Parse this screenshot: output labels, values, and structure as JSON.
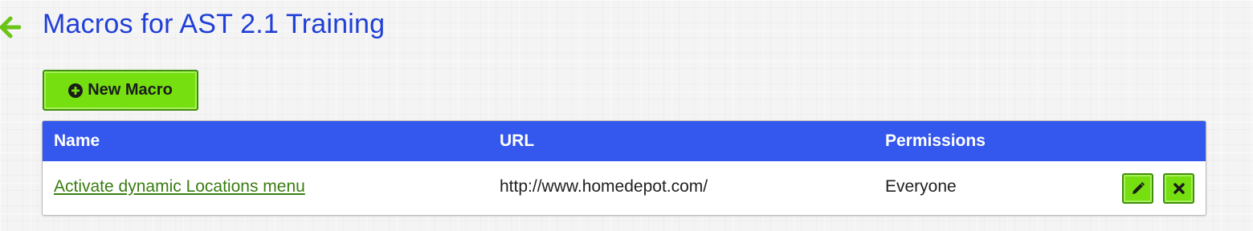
{
  "header": {
    "back_icon": "arrow-left-icon",
    "title": "Macros for AST 2.1 Training"
  },
  "toolbar": {
    "new_macro_label": "New Macro",
    "new_macro_icon": "plus-circle-icon"
  },
  "table": {
    "columns": [
      "Name",
      "URL",
      "Permissions"
    ],
    "rows": [
      {
        "name": "Activate dynamic Locations menu",
        "url": "http://www.homedepot.com/",
        "permissions": "Everyone",
        "actions": [
          "pencil-icon",
          "x-icon"
        ]
      }
    ]
  },
  "colors": {
    "title": "#1f3fd6",
    "header_bg": "#3457ee",
    "button_green": "#76df10",
    "button_border": "#3e8f0b",
    "link_green": "#3a7d10",
    "back_arrow": "#6cc417"
  }
}
